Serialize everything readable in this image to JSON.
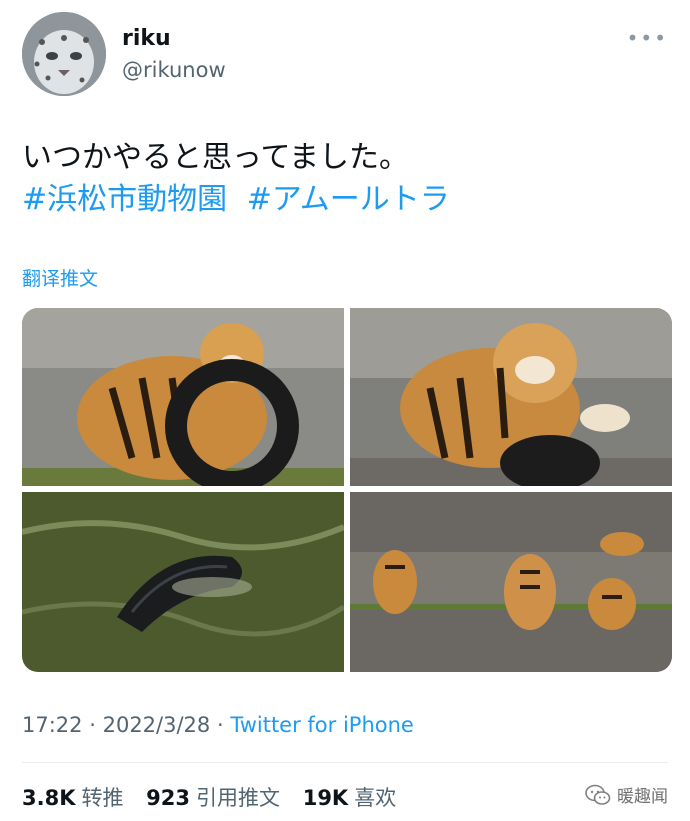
{
  "tweet": {
    "display_name": "riku",
    "handle": "@rikunow",
    "more_icon": "more-horizontal-icon",
    "text": "いつかやると思ってました。",
    "hashtags": [
      "#浜松市動物園",
      "#アムールトラ"
    ],
    "translate_label": "翻译推文",
    "time": "17:22",
    "date": "2022/3/28",
    "separator": "·",
    "source": "Twitter for iPhone"
  },
  "stats": {
    "retweets": {
      "count": "3.8K",
      "label": "转推"
    },
    "quotes": {
      "count": "923",
      "label": "引用推文"
    },
    "likes": {
      "count": "19K",
      "label": "喜欢"
    }
  },
  "watermark": {
    "text": "暖趣闻",
    "icon": "wechat-logo-icon"
  },
  "colors": {
    "link": "#1d9bf0",
    "secondary": "#536471",
    "text": "#0f1419"
  }
}
